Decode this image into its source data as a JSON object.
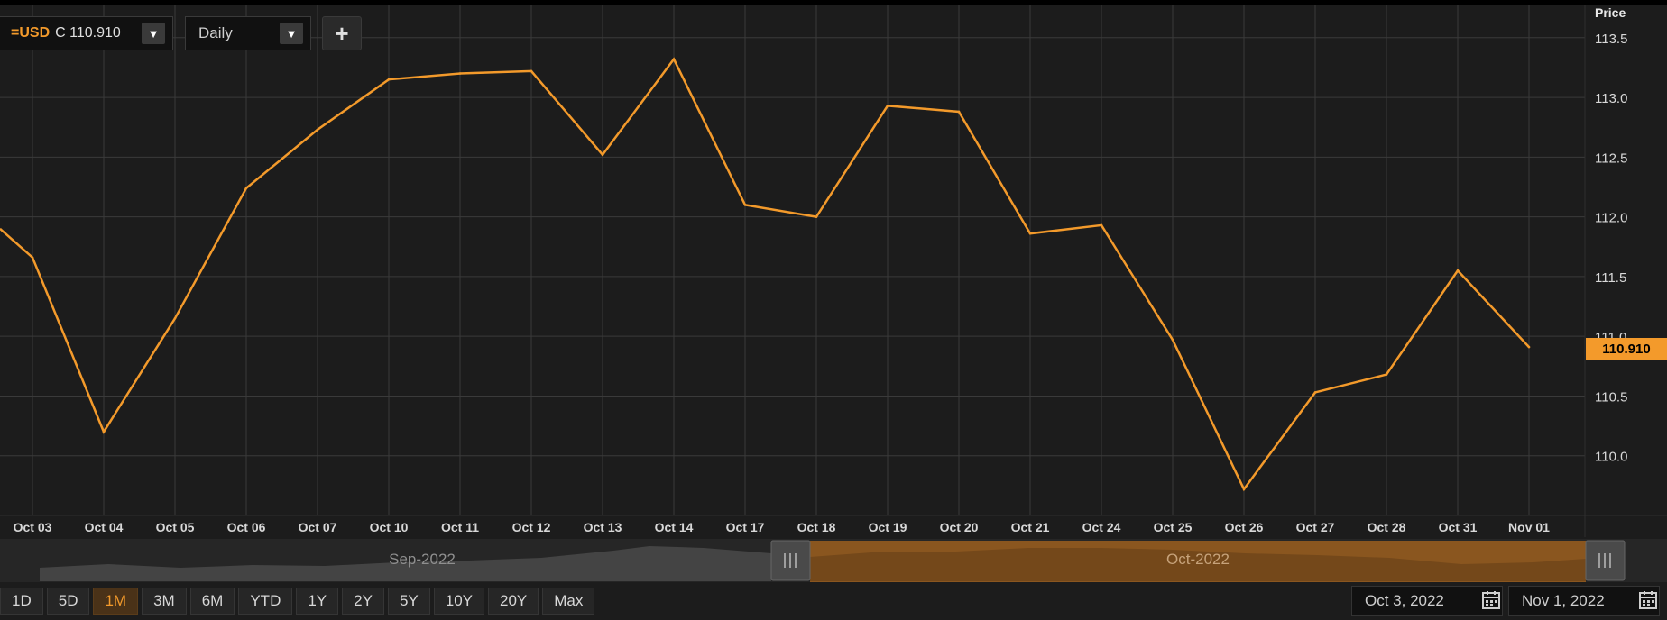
{
  "symbol": {
    "name": "=USD",
    "price": "C 110.910"
  },
  "interval": {
    "label": "Daily"
  },
  "add_label": "+",
  "price_axis_title": "Price",
  "last_price_label": "110.910",
  "range_buttons": [
    "1D",
    "5D",
    "1M",
    "3M",
    "6M",
    "YTD",
    "1Y",
    "2Y",
    "5Y",
    "10Y",
    "20Y",
    "Max"
  ],
  "active_range": "1M",
  "date_from": "Oct 3, 2022",
  "date_to": "Nov 1, 2022",
  "navigator": {
    "left_label": "Sep-2022",
    "right_label": "Oct-2022"
  },
  "colors": {
    "line": "#f39a2b",
    "grid": "#3a3a3a",
    "background": "#1c1c1c",
    "accent": "#f39a2b"
  },
  "icons": {
    "dropdown": "triangle-down-icon",
    "calendar": "calendar-icon",
    "add": "plus-icon"
  },
  "chart_data": {
    "type": "line",
    "categories": [
      "Oct 03",
      "Oct 04",
      "Oct 05",
      "Oct 06",
      "Oct 07",
      "Oct 10",
      "Oct 11",
      "Oct 12",
      "Oct 13",
      "Oct 14",
      "Oct 17",
      "Oct 18",
      "Oct 19",
      "Oct 20",
      "Oct 21",
      "Oct 24",
      "Oct 25",
      "Oct 26",
      "Oct 27",
      "Oct 28",
      "Oct 31",
      "Nov 01"
    ],
    "series": [
      {
        "values": [
          111.66,
          110.2,
          111.15,
          112.24,
          112.73,
          113.15,
          113.2,
          113.22,
          112.52,
          113.32,
          112.1,
          112.0,
          112.93,
          112.88,
          111.86,
          111.93,
          110.97,
          109.72,
          110.53,
          110.68,
          111.55,
          110.91
        ]
      }
    ],
    "start_value": 111.9,
    "yticks": [
      110.0,
      110.5,
      111.0,
      111.5,
      112.0,
      112.5,
      113.0,
      113.5
    ],
    "ylim": [
      109.5,
      113.77
    ],
    "ylabel": "Price",
    "grid": true
  }
}
